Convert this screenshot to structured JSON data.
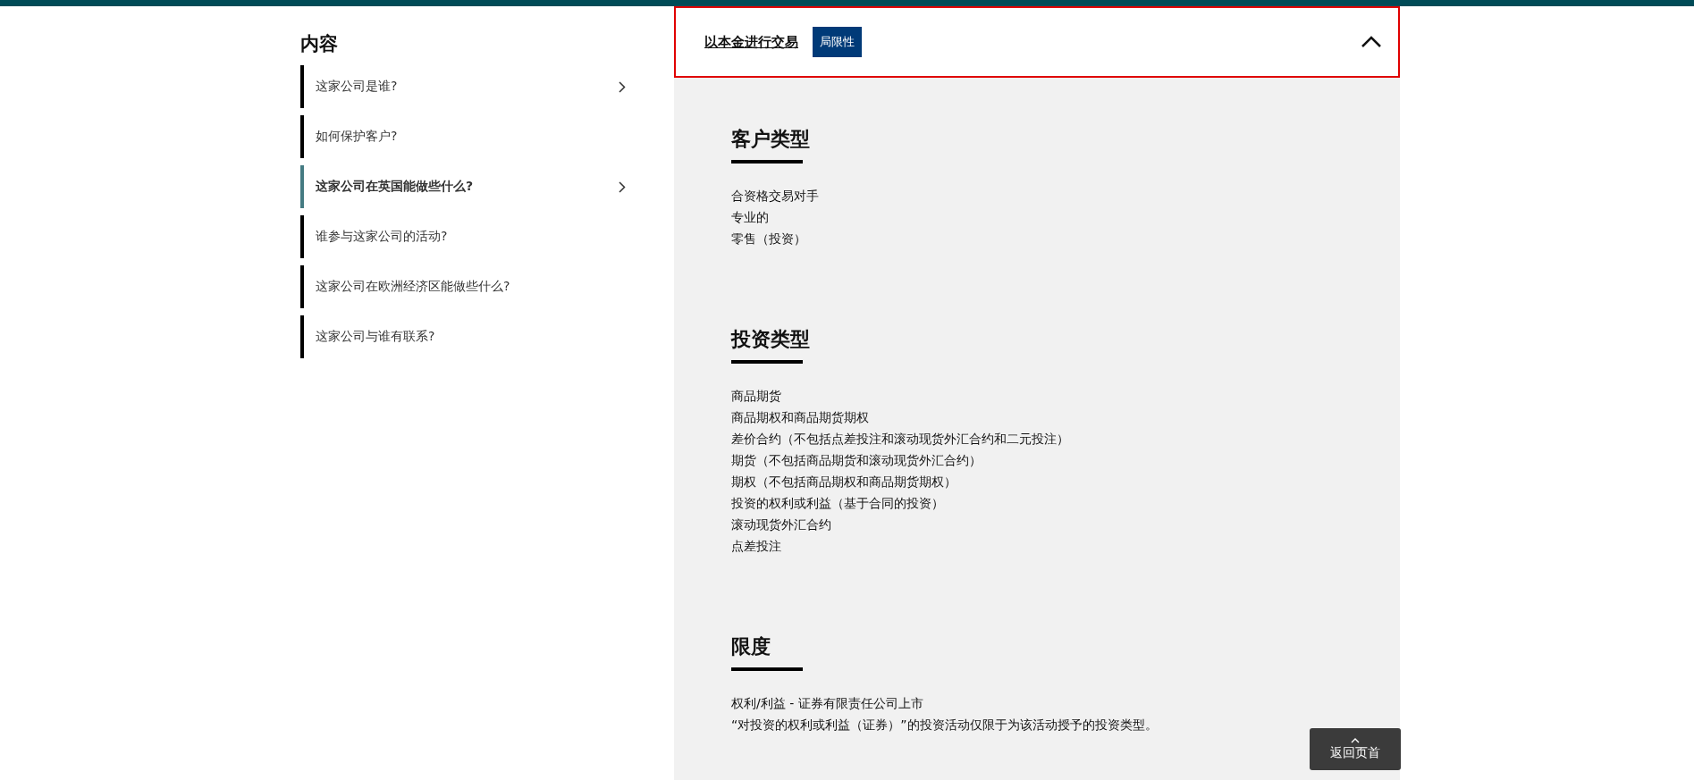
{
  "sidebar": {
    "title": "内容",
    "items": [
      {
        "label": "这家公司是谁?",
        "selected": false,
        "expandable": true
      },
      {
        "label": "如何保护客户?",
        "selected": false,
        "expandable": false
      },
      {
        "label": "这家公司在英国能做些什么?",
        "selected": true,
        "expandable": true
      },
      {
        "label": "谁参与这家公司的活动?",
        "selected": false,
        "expandable": false
      },
      {
        "label": "这家公司在欧洲经济区能做些什么?",
        "selected": false,
        "expandable": false
      },
      {
        "label": "这家公司与谁有联系?",
        "selected": false,
        "expandable": false
      }
    ]
  },
  "panel": {
    "title": "以本金进行交易",
    "tag": "局限性",
    "expanded": true
  },
  "sections": [
    {
      "heading": "客户类型",
      "lines": [
        "合资格交易对手",
        "专业的",
        "零售（投资）"
      ]
    },
    {
      "heading": "投资类型",
      "lines": [
        "商品期货",
        "商品期权和商品期货期权",
        "差价合约（不包括点差投注和滚动现货外汇合约和二元投注）",
        "期货（不包括商品期货和滚动现货外汇合约）",
        "期权（不包括商品期权和商品期货期权）",
        "投资的权利或利益（基于合同的投资）",
        "滚动现货外汇合约",
        "点差投注"
      ]
    },
    {
      "heading": "限度",
      "lines": [
        "权利/利益 - 证券有限责任公司上市",
        "“对投资的权利或利益（证券）”的投资活动仅限于为该活动授予的投资类型。"
      ]
    }
  ],
  "back_to_top": {
    "label": "返回页首"
  }
}
